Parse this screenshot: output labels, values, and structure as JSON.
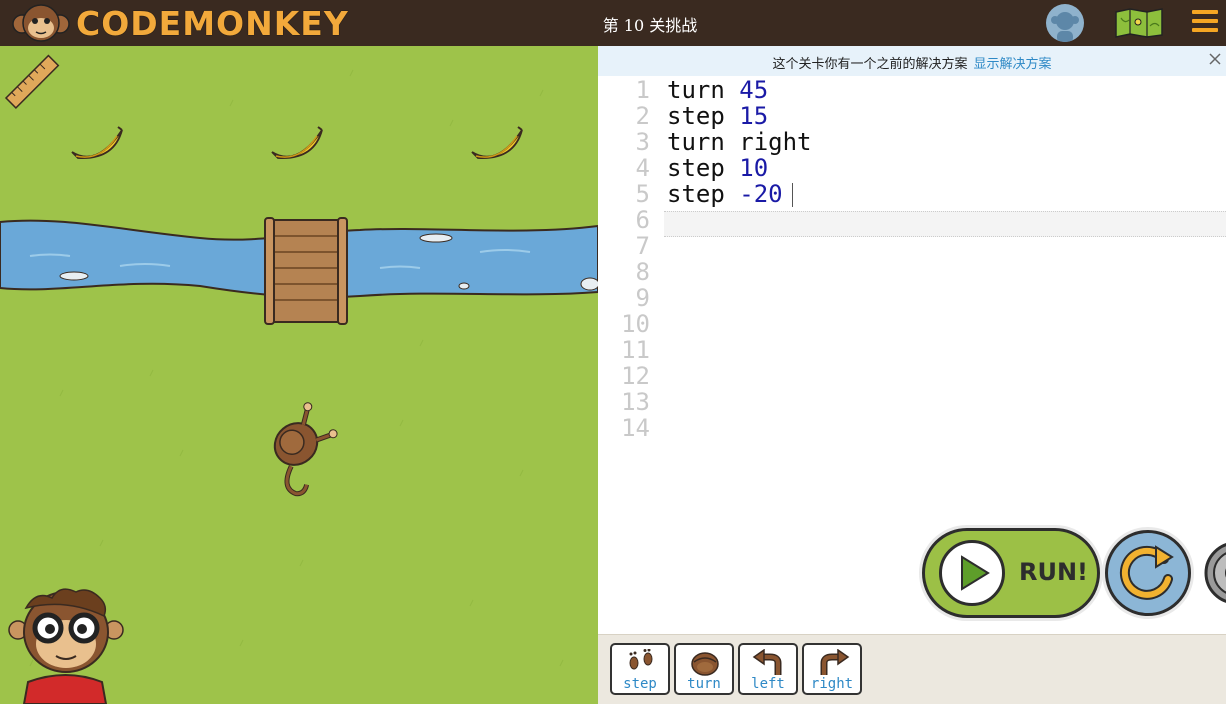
{
  "header": {
    "brand": "CODEMONKEY",
    "level_title": "第 10 关挑战"
  },
  "notice": {
    "text": "这个关卡你有一个之前的解决方案",
    "link": "显示解决方案"
  },
  "editor": {
    "line_numbers": [
      "1",
      "2",
      "3",
      "4",
      "5",
      "6",
      "7",
      "8",
      "9",
      "10",
      "11",
      "12",
      "13",
      "14"
    ],
    "lines": [
      {
        "cmd": "turn",
        "arg": "45"
      },
      {
        "cmd": "step",
        "arg": "15"
      },
      {
        "cmd": "turn",
        "arg": "right"
      },
      {
        "cmd": "step",
        "arg": "10"
      },
      {
        "cmd": "step",
        "arg": "-20"
      }
    ]
  },
  "controls": {
    "run_label": "RUN!"
  },
  "toolbar": {
    "commands": [
      "step",
      "turn",
      "left",
      "right"
    ]
  },
  "colors": {
    "topbar": "#3a2a20",
    "brand": "#f2a93b",
    "grass": "#9ec34a",
    "river": "#6aa8d8",
    "link": "#2e89c6",
    "number": "#1a1aa6",
    "run_button": "#9cc046",
    "reset_button": "#8cb6d6"
  }
}
